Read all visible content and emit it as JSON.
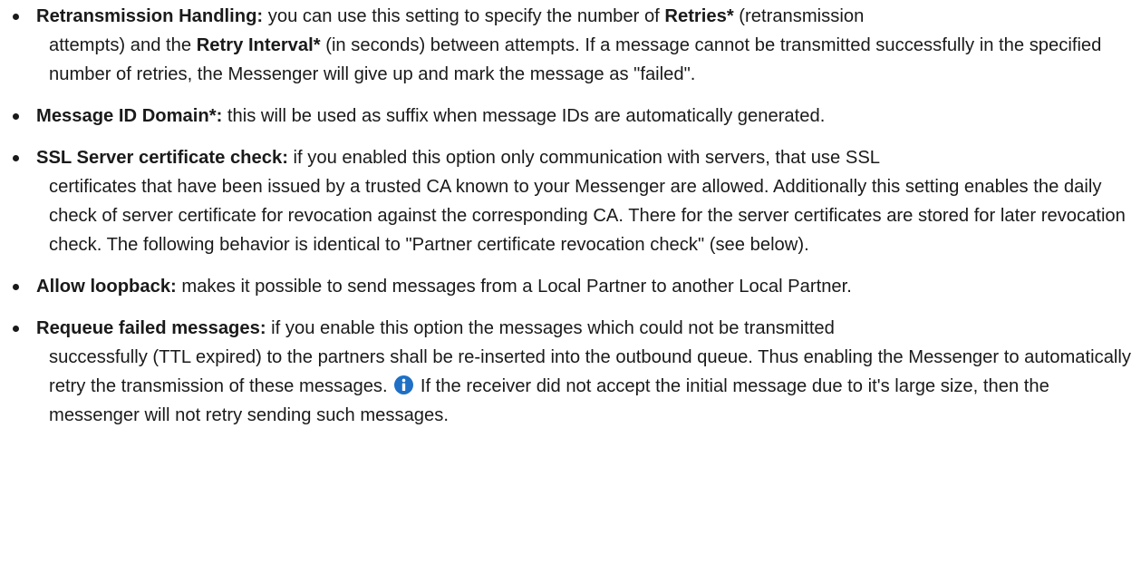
{
  "items": [
    {
      "term": "Retransmission Handling:",
      "text_a": " you can use this setting to specify the number of ",
      "bold_a": "Retries*",
      "text_b": " (retransmission",
      "cont_a": "attempts) and the ",
      "bold_b": "Retry Interval*",
      "text_c": " (in seconds) between attempts. If a message cannot be transmitted successfully in the specified number of retries, the Messenger will give up and mark the message as \"failed\"."
    },
    {
      "term": "Message ID Domain*:",
      "text": " this will be used as suffix when message IDs are automatically generated."
    },
    {
      "term": "SSL Server certificate check:",
      "text_a": " if you enabled this option only communication with servers, that use SSL",
      "cont": "certificates that have been issued by a trusted CA known to your Messenger are allowed. Additionally this setting enables the daily check of server certificate for revocation against the corresponding CA. There for the server certificates are stored for later revocation check. The following behavior is identical to \"Partner certificate revocation check\" (see below)."
    },
    {
      "term": "Allow loopback:",
      "text": " makes it possible to send messages from a Local Partner to another Local Partner."
    },
    {
      "term": "Requeue failed messages:",
      "text_a": " if you enable this option the messages which could not be transmitted",
      "cont_a": "successfully (TTL expired) to the partners shall be re-inserted into the outbound queue. Thus enabling the Messenger to automatically retry the transmission of these messages. ",
      "cont_b": " If the receiver did not accept the initial message due to it's large size, then the messenger will not retry sending such messages.",
      "icon": "info-icon",
      "icon_color": "#1f6fc5"
    }
  ]
}
